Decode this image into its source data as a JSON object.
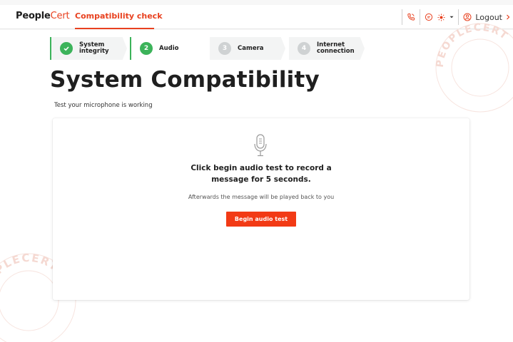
{
  "header": {
    "logo_main": "People",
    "logo_accent": "Cert",
    "nav_title": "Compatibility check",
    "logout_label": "Logout",
    "icons": [
      "phone-icon",
      "chat-icon",
      "theme-sun-icon",
      "chevron-down-icon",
      "user-circle-icon",
      "chevron-right-icon"
    ]
  },
  "stepper": {
    "steps": [
      {
        "number": "✓",
        "label_line1": "System",
        "label_line2": "integrity",
        "status": "done"
      },
      {
        "number": "2",
        "label_line1": "Audio",
        "label_line2": "",
        "status": "current"
      },
      {
        "number": "3",
        "label_line1": "Camera",
        "label_line2": "",
        "status": "pending"
      },
      {
        "number": "4",
        "label_line1": "Internet",
        "label_line2": "connection",
        "status": "pending"
      }
    ]
  },
  "page": {
    "title": "System Compatibility",
    "subtitle": "Test your microphone is working"
  },
  "card": {
    "heading_line1": "Click begin audio test to record a",
    "heading_line2": "message for 5 seconds.",
    "note": "Afterwards the message will be played back to you",
    "button_label": "Begin audio test"
  },
  "watermark_text": "PEOPLECERT",
  "colors": {
    "accent": "#e8411f",
    "button": "#f23a15",
    "success": "#3cb35a",
    "pending": "#cfd2d3"
  }
}
